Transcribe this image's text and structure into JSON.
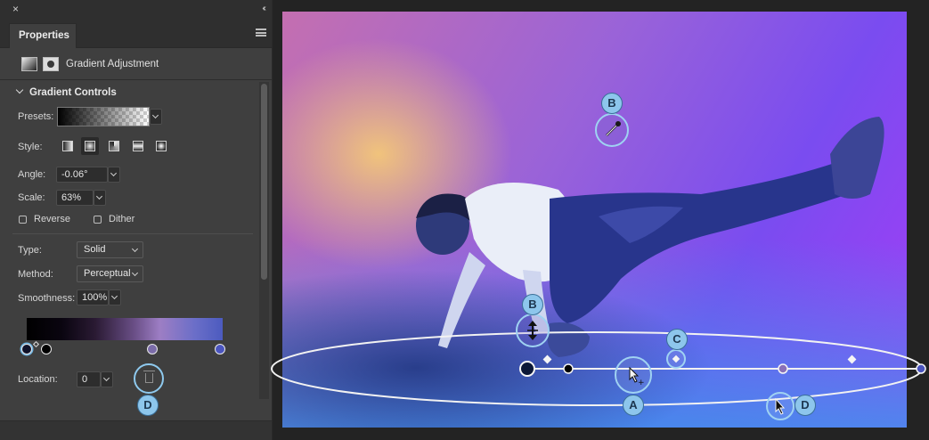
{
  "panel": {
    "close_glyph": "×",
    "collapse_glyph": "‹‹",
    "tab_label": "Properties",
    "adjustment_title": "Gradient Adjustment",
    "section_title": "Gradient Controls",
    "presets_label": "Presets:",
    "style_label": "Style:",
    "style_options": [
      "linear",
      "radial",
      "angle",
      "reflected",
      "diamond"
    ],
    "style_selected": "radial",
    "angle_label": "Angle:",
    "angle_value": "-0.06°",
    "scale_label": "Scale:",
    "scale_value": "63%",
    "reverse_label": "Reverse",
    "dither_label": "Dither",
    "reverse_checked": false,
    "dither_checked": false,
    "type_label": "Type:",
    "type_value": "Solid",
    "method_label": "Method:",
    "method_value": "Perceptual",
    "smoothness_label": "Smoothness:",
    "smoothness_value": "100%",
    "location_label": "Location:",
    "location_value": "0",
    "gradient_stop_colors": [
      "#10122a",
      "#000000",
      "#7b6ca9",
      "#4b55bf"
    ]
  },
  "callouts": {
    "A": "A",
    "B": "B",
    "C": "C",
    "D": "D"
  },
  "colors": {
    "accent_highlight": "#8dc6ec",
    "panel_bg": "#3f3f3f",
    "app_bg": "#232323"
  },
  "icons": [
    "close-icon",
    "panel-collapse-icon",
    "panel-menu-icon",
    "gradient-adjustment-icon",
    "mask-icon",
    "chevron-down-icon",
    "eyedropper-icon",
    "trash-icon",
    "move-cursor-icon",
    "arrow-cursor-icon"
  ]
}
